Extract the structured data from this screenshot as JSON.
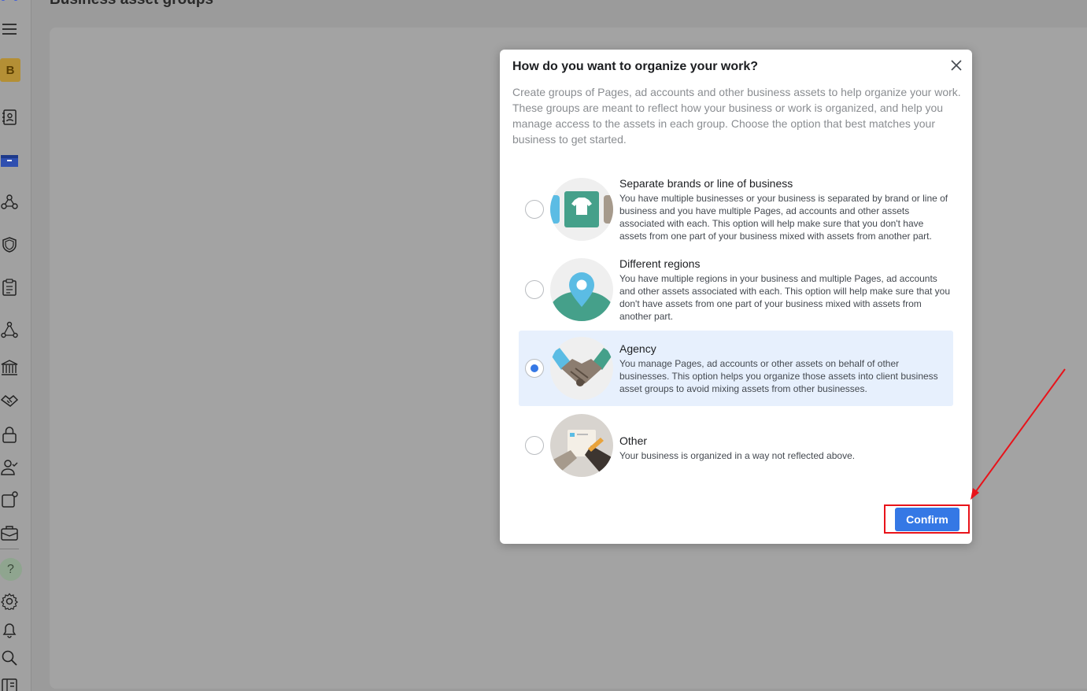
{
  "page": {
    "title": "Business asset groups"
  },
  "sidebar": {
    "avatar_letter": "B",
    "help_label": "?",
    "icons": [
      "menu-icon",
      "contact-book-icon",
      "archive-box-icon",
      "people-network-icon",
      "shield-icon",
      "clipboard-icon",
      "triangle-nodes-icon",
      "bank-icon",
      "handshake-icon",
      "lock-icon",
      "person-check-icon",
      "notification-square-icon",
      "briefcase-icon",
      "gear-icon",
      "bell-icon",
      "search-icon",
      "book-icon"
    ]
  },
  "dialog": {
    "title": "How do you want to organize your work?",
    "description": "Create groups of Pages, ad accounts and other business assets to help organize your work. These groups are meant to reflect how your business or work is organized, and help you manage access to the assets in each group. Choose the option that best matches your business to get started.",
    "options": [
      {
        "title": "Separate brands or line of business",
        "description": "You have multiple businesses or your business is separated by brand or line of business and you have multiple Pages, ad accounts and other assets associated with each. This option will help make sure that you don't have assets from one part of your business mixed with assets from another part.",
        "selected": false
      },
      {
        "title": "Different regions",
        "description": "You have multiple regions in your business and multiple Pages, ad accounts and other assets associated with each. This option will help make sure that you don't have assets from one part of your business mixed with assets from another part.",
        "selected": false
      },
      {
        "title": "Agency",
        "description": "You manage Pages, ad accounts or other assets on behalf of other businesses. This option helps you organize those assets into client business asset groups to avoid mixing assets from other businesses.",
        "selected": true
      },
      {
        "title": "Other",
        "description": "Your business is organized in a way not reflected above.",
        "selected": false
      }
    ],
    "confirm_label": "Confirm"
  },
  "colors": {
    "accent": "#3578e5",
    "annotation": "#e8131a",
    "selected_bg": "#e7f0fd"
  }
}
